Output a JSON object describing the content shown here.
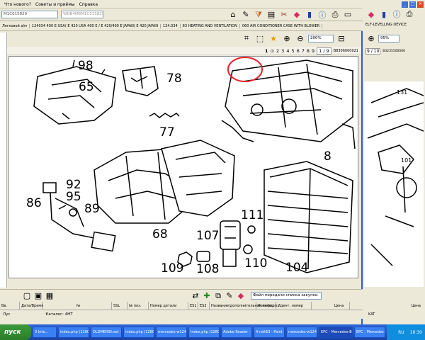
{
  "menu": [
    "Что нового?",
    "Советы и приёмы",
    "Справка"
  ],
  "toolbar": {
    "vin_value": "M1C015829",
    "vin2_value": "WDB4M6M1C015829"
  },
  "path": [
    "Легковой а/м",
    "124034 400 E USA( E 420 USA 400 E / E 420/400 E JAPAN( E 420 JAPAN",
    "124.034",
    "83 HEATING AND VENTILATION",
    "060 AIR CONDITIONER CASE WITH BLOWER"
  ],
  "view": {
    "zoom": "200%"
  },
  "pagenav": {
    "pages": [
      "1",
      "2",
      "3",
      "4",
      "5",
      "6",
      "7",
      "8",
      "9"
    ],
    "counter": "1 / 9",
    "code": "B8306000021"
  },
  "diagram_labels": [
    "98",
    "65",
    "78",
    "77",
    "8",
    "92",
    "95",
    "86",
    "89",
    "111",
    "68",
    "107",
    "109",
    "108",
    "110",
    "104"
  ],
  "bottom": {
    "transfer_label": "Файл передачи списка закупки"
  },
  "table_headers": [
    "Вв.",
    "Дата/Время",
    "№",
    "SSL",
    "№ поз.",
    "Номер детали",
    "ES1",
    "ES2",
    "Название/дополнительная информ...",
    "Количес...",
    "Идент. номер",
    "Цена"
  ],
  "status": {
    "left": "Лус",
    "catalog": "Каталог: 4НТ"
  },
  "right_window": {
    "title": "ELF-LEVELLING DEVICE",
    "zoom": "95%",
    "counter": "9 / 10",
    "code": "B3235500006",
    "labels": [
      "131",
      "101"
    ],
    "col": "Цена",
    "status": "KAT"
  },
  "taskbar": {
    "start": "пуск",
    "tasks": [
      "3 Inte...",
      "index.php (1280 ...",
      "OLDMERIN.net -...",
      "index.php (1280 ...",
      "mercedes-w124-...",
      "index.php (1280 ...",
      "Adobe Reader - ...",
      "4-ratt63 - Paint",
      "mercedes-w124-...",
      "Adobe Reader - ...",
      "4-ratt63 - Paint",
      "EPC - Mercedes-B...",
      "EPC - Mercedes-B..."
    ],
    "lang": "RU",
    "clock": "10:30"
  },
  "colors": {
    "highlight": "#e8202a",
    "taskbar": "#245edb",
    "start": "#3c9a3c"
  }
}
